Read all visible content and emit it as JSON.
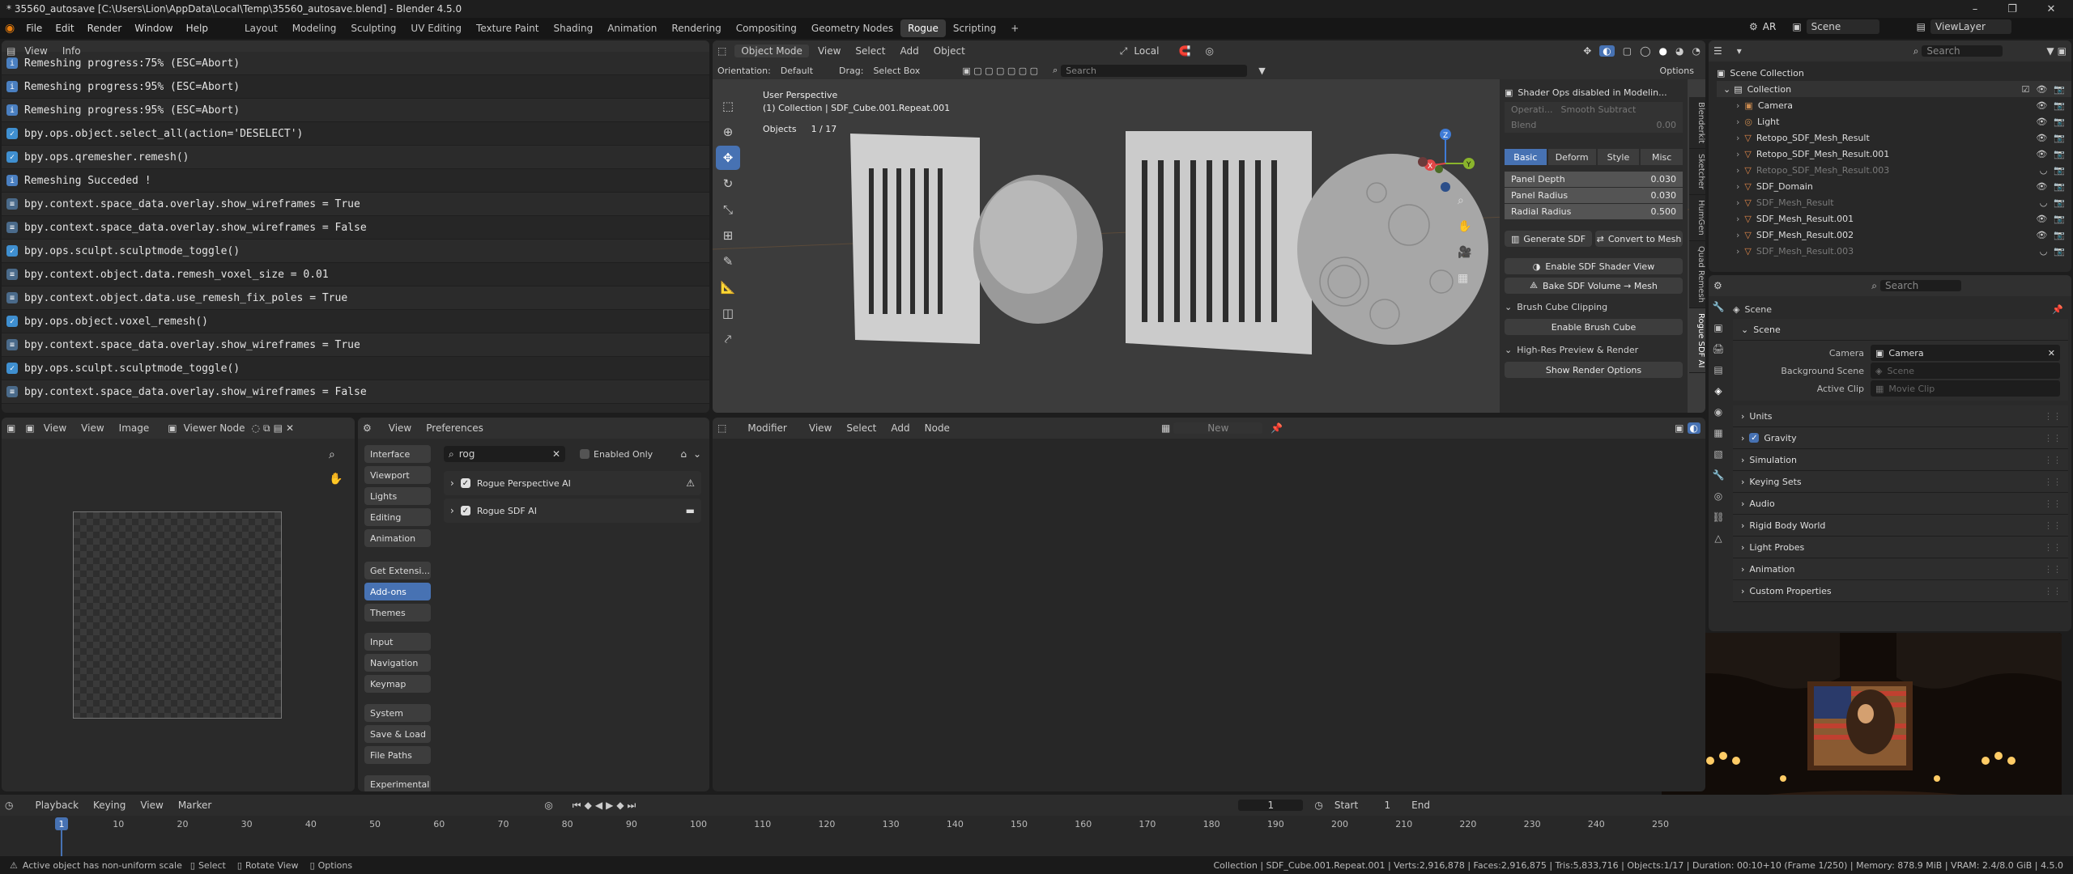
{
  "window": {
    "title": "* 35560_autosave [C:\\Users\\Lion\\AppData\\Local\\Temp\\35560_autosave.blend] - Blender 4.5.0",
    "minimize": "–",
    "maximize": "❐",
    "close": "✕"
  },
  "menu": [
    "File",
    "Edit",
    "Render",
    "Window",
    "Help"
  ],
  "workspaces": [
    "Layout",
    "Modeling",
    "Sculpting",
    "UV Editing",
    "Texture Paint",
    "Shading",
    "Animation",
    "Rendering",
    "Compositing",
    "Geometry Nodes",
    "Rogue",
    "Scripting",
    "+"
  ],
  "active_workspace": "Rogue",
  "top_right": {
    "engine": "AR",
    "scene": "Scene",
    "view_layer": "ViewLayer"
  },
  "info": {
    "menus": [
      "View",
      "Info"
    ],
    "lines": [
      {
        "icon": "report",
        "text": "Remeshing progress:75% (ESC=Abort)"
      },
      {
        "icon": "report",
        "text": "Remeshing progress:95% (ESC=Abort)"
      },
      {
        "icon": "report",
        "text": "Remeshing progress:95% (ESC=Abort)"
      },
      {
        "icon": "op",
        "text": "bpy.ops.object.select_all(action='DESELECT')"
      },
      {
        "icon": "op",
        "text": "bpy.ops.qremesher.remesh()"
      },
      {
        "icon": "report",
        "text": "Remeshing Succeded !"
      },
      {
        "icon": "prop",
        "text": "bpy.context.space_data.overlay.show_wireframes = True"
      },
      {
        "icon": "prop",
        "text": "bpy.context.space_data.overlay.show_wireframes = False"
      },
      {
        "icon": "op",
        "text": "bpy.ops.sculpt.sculptmode_toggle()"
      },
      {
        "icon": "prop",
        "text": "bpy.context.object.data.remesh_voxel_size = 0.01"
      },
      {
        "icon": "prop",
        "text": "bpy.context.object.data.use_remesh_fix_poles = True"
      },
      {
        "icon": "op",
        "text": "bpy.ops.object.voxel_remesh()"
      },
      {
        "icon": "prop",
        "text": "bpy.context.space_data.overlay.show_wireframes = True"
      },
      {
        "icon": "op",
        "text": "bpy.ops.sculpt.sculptmode_toggle()"
      },
      {
        "icon": "prop",
        "text": "bpy.context.space_data.overlay.show_wireframes = False"
      }
    ]
  },
  "viewport": {
    "mode": "Object Mode",
    "menus": [
      "View",
      "Select",
      "Add",
      "Object"
    ],
    "transform": "Local",
    "orientation_label": "Orientation:",
    "orientation": "Default",
    "drag_label": "Drag:",
    "drag": "Select Box",
    "search_placeholder": "Search",
    "options": "Options",
    "view_name": "User Perspective",
    "collection": "(1) Collection | SDF_Cube.001.Repeat.001",
    "objects_label": "Objects",
    "objects_count": "1 / 17",
    "gizmo": {
      "x": "X",
      "y": "Y",
      "z": "Z"
    }
  },
  "npanel": {
    "warning": "Shader Ops disabled in Modelin...",
    "operation_label": "Operati...",
    "operation": "Smooth Subtract",
    "blend_label": "Blend",
    "blend": "0.00",
    "tabs": [
      "Basic",
      "Deform",
      "Style",
      "Misc"
    ],
    "fields": [
      {
        "label": "Panel Depth",
        "value": "0.030"
      },
      {
        "label": "Panel Radius",
        "value": "0.030"
      },
      {
        "label": "Radial Radius",
        "value": "0.500"
      }
    ],
    "generate": "Generate SDF",
    "convert": "Convert to Mesh",
    "enable_shader": "Enable SDF Shader View",
    "bake": "Bake SDF Volume → Mesh",
    "clipping_header": "Brush Cube Clipping",
    "enable_brush": "Enable Brush Cube",
    "hires_header": "High-Res Preview & Render",
    "show_render": "Show Render Options",
    "side_tabs": [
      "Blenderkit",
      "Sketcher",
      "HumGen",
      "Quad Remesh",
      "Rogue SDF AI"
    ]
  },
  "outliner": {
    "search_placeholder": "Search",
    "root": "Scene Collection",
    "collection": "Collection",
    "items": [
      {
        "name": "Camera",
        "type": "camera",
        "dim": false
      },
      {
        "name": "Light",
        "type": "light",
        "dim": false
      },
      {
        "name": "Retopo_SDF_Mesh_Result",
        "type": "mesh",
        "dim": false
      },
      {
        "name": "Retopo_SDF_Mesh_Result.001",
        "type": "mesh",
        "dim": false
      },
      {
        "name": "Retopo_SDF_Mesh_Result.003",
        "type": "mesh",
        "dim": true
      },
      {
        "name": "SDF_Domain",
        "type": "mesh",
        "dim": false
      },
      {
        "name": "SDF_Mesh_Result",
        "type": "mesh",
        "dim": true
      },
      {
        "name": "SDF_Mesh_Result.001",
        "type": "mesh",
        "dim": false
      },
      {
        "name": "SDF_Mesh_Result.002",
        "type": "mesh",
        "dim": false
      },
      {
        "name": "SDF_Mesh_Result.003",
        "type": "mesh",
        "dim": true
      }
    ]
  },
  "properties": {
    "search_placeholder": "Search",
    "context": "Scene",
    "section": "Scene",
    "camera_label": "Camera",
    "camera": "Camera",
    "bg_label": "Background Scene",
    "bg_placeholder": "Scene",
    "clip_label": "Active Clip",
    "clip_placeholder": "Movie Clip",
    "sections": [
      "Units",
      "Gravity",
      "Simulation",
      "Keying Sets",
      "Audio",
      "Rigid Body World",
      "Light Probes",
      "Animation",
      "Custom Properties"
    ]
  },
  "image_editor": {
    "menus": [
      "View",
      "View",
      "Image"
    ],
    "node": "Viewer Node"
  },
  "preferences": {
    "menus": [
      "View",
      "Preferences"
    ],
    "search": "rog",
    "enabled_only": "Enabled Only",
    "categories": [
      "Interface",
      "Viewport",
      "Lights",
      "Editing",
      "Animation",
      "Get Extensi...",
      "Add-ons",
      "Themes",
      "Input",
      "Navigation",
      "Keymap",
      "System",
      "Save & Load",
      "File Paths",
      "Experimental"
    ],
    "active": "Add-ons",
    "addons": [
      {
        "name": "Rogue Perspective AI",
        "icon": "⚠"
      },
      {
        "name": "Rogue SDF AI",
        "icon": "▬"
      }
    ]
  },
  "node_editor": {
    "type": "Modifier",
    "menus": [
      "View",
      "Select",
      "Add",
      "Node"
    ],
    "new": "New"
  },
  "timeline": {
    "menus": [
      "Playback",
      "Keying",
      "View",
      "Marker"
    ],
    "current_frame": "1",
    "start_label": "Start",
    "start": "1",
    "end_label": "End",
    "ticks": [
      "1",
      "10",
      "20",
      "30",
      "40",
      "50",
      "60",
      "70",
      "80",
      "90",
      "100",
      "110",
      "120",
      "130",
      "140",
      "150",
      "160",
      "170",
      "180",
      "190",
      "200",
      "210",
      "220",
      "230",
      "240",
      "250"
    ]
  },
  "status": {
    "message": "Active object has non-uniform scale",
    "select": "Select",
    "rotate": "Rotate View",
    "options": "Options",
    "stats": "Collection | SDF_Cube.001.Repeat.001 | Verts:2,916,878 | Faces:2,916,875 | Tris:5,833,716 | Objects:1/17 | Duration: 00:10+10 (Frame 1/250) | Memory: 878.9 MiB | VRAM: 2.4/8.0 GiB | 4.5.0"
  },
  "colors": {
    "accent": "#4772b3",
    "x_axis": "#e04646",
    "y_axis": "#8ab42c",
    "z_axis": "#3f7bd6",
    "mesh_icon": "#e0874a",
    "camera_icon": "#c98a4f"
  }
}
